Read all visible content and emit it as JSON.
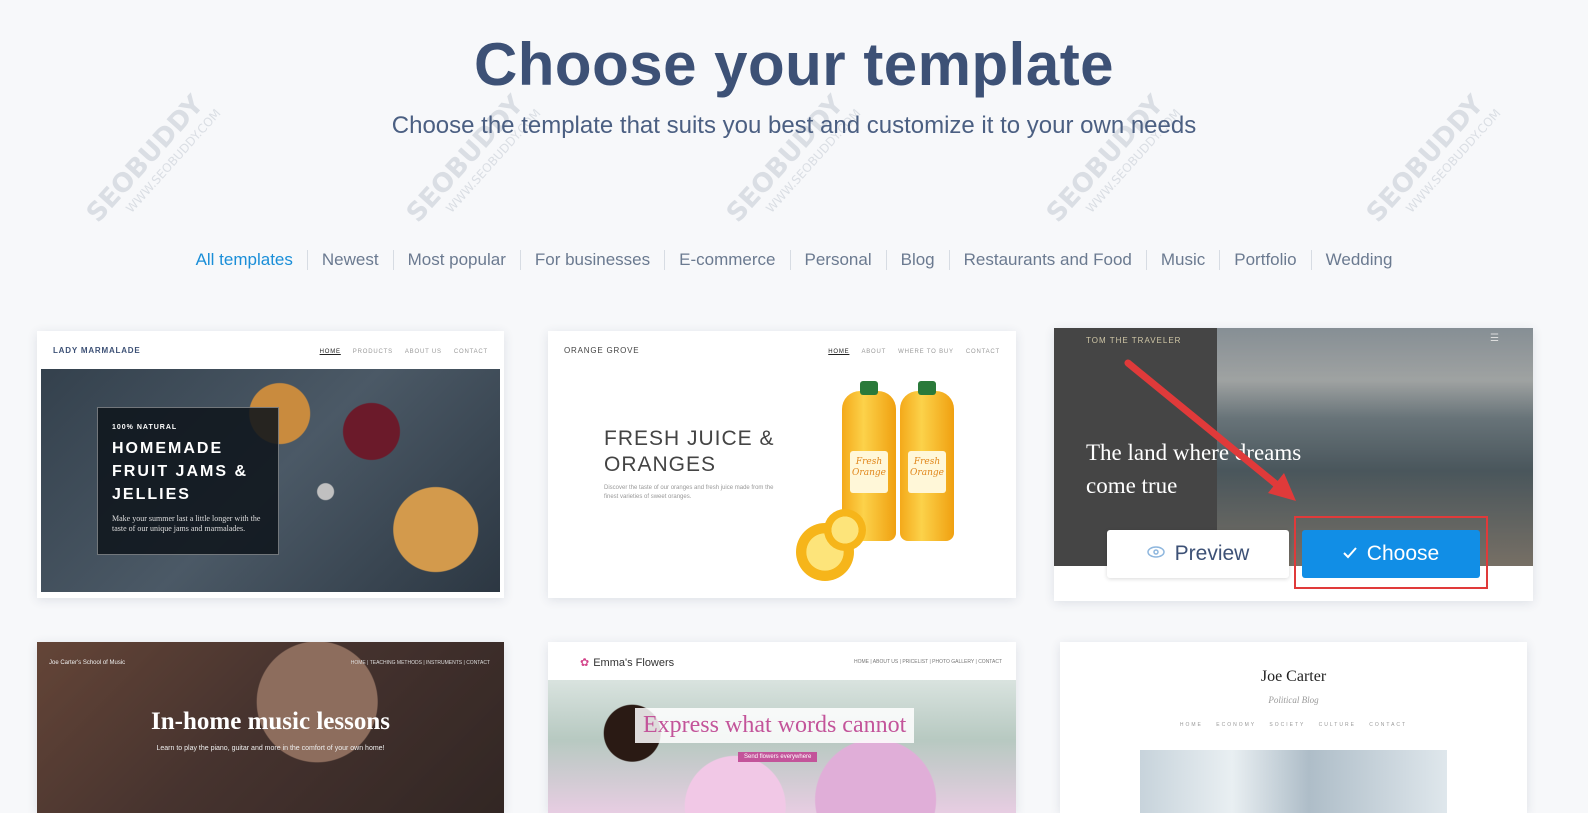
{
  "header": {
    "title": "Choose your template",
    "subtitle": "Choose the template that suits you best and customize it to your own needs"
  },
  "filters": [
    {
      "label": "All templates",
      "active": true
    },
    {
      "label": "Newest"
    },
    {
      "label": "Most popular"
    },
    {
      "label": "For businesses"
    },
    {
      "label": "E-commerce"
    },
    {
      "label": "Personal"
    },
    {
      "label": "Blog"
    },
    {
      "label": "Restaurants and Food"
    },
    {
      "label": "Music"
    },
    {
      "label": "Portfolio"
    },
    {
      "label": "Wedding"
    }
  ],
  "templates": [
    {
      "logo": "LADY MARMALADE",
      "nav": [
        "HOME",
        "PRODUCTS",
        "ABOUT US",
        "CONTACT"
      ],
      "kicker": "100% NATURAL",
      "headline": "HOMEMADE FRUIT JAMS & JELLIES",
      "blurb": "Make your summer last a little longer with the taste of our unique jams and marmalades."
    },
    {
      "logo": "ORANGE GROVE",
      "nav": [
        "HOME",
        "ABOUT",
        "WHERE TO BUY",
        "CONTACT"
      ],
      "headline": "FRESH JUICE & ORANGES",
      "blurb": "Discover the taste of our oranges and fresh juice made from the finest varieties of sweet oranges.",
      "bottle_label": "Fresh Orange"
    },
    {
      "logo": "TOM THE TRAVELER",
      "menu_icon": "hamburger-icon",
      "headline": "The land where dreams come true",
      "preview_label": "Preview",
      "choose_label": "Choose"
    },
    {
      "logo": "Joe Carter's School of Music",
      "nav": "HOME | TEACHING METHODS | INSTRUMENTS | CONTACT",
      "headline": "In-home music lessons",
      "blurb": "Learn to play the piano, guitar and more in the comfort of your own home!"
    },
    {
      "logo": "Emma's Flowers",
      "nav": "HOME | ABOUT US | PRICELIST | PHOTO GALLERY | CONTACT",
      "headline": "Express what words cannot",
      "sub": "Send flowers everywhere"
    },
    {
      "name": "Joe Carter",
      "sub": "Political Blog",
      "nav": "HOME ECONOMY SOCIETY CULTURE CONTACT"
    }
  ],
  "annotation": {
    "color": "#e03a3a"
  },
  "watermark": {
    "brand": "SEOBUDDY",
    "site": "WWW.SEOBUDDY.COM"
  },
  "colors": {
    "accent": "#118ee6",
    "title": "#3d5176",
    "active_filter": "#1a8ed8"
  }
}
